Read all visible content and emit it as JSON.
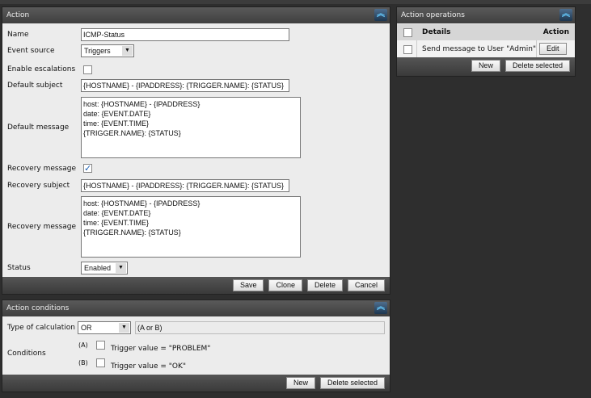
{
  "action": {
    "title": "Action",
    "name_label": "Name",
    "name_value": "ICMP-Status",
    "event_source_label": "Event source",
    "event_source_value": "Triggers",
    "escalations_label": "Enable escalations",
    "default_subject_label": "Default subject",
    "default_subject_value": "{HOSTNAME} - {IPADDRESS}: {TRIGGER.NAME}: {STATUS}",
    "default_message_label": "Default message",
    "default_message_lines": [
      "host: {HOSTNAME} - {IPADDRESS}",
      "date: {EVENT.DATE}",
      "time: {EVENT.TIME}",
      "{TRIGGER.NAME}: {STATUS}"
    ],
    "recovery_checkbox_label": "Recovery message",
    "recovery_subject_label": "Recovery subject",
    "recovery_subject_value": "{HOSTNAME} - {IPADDRESS}: {TRIGGER.NAME}: {STATUS}",
    "recovery_message_label": "Recovery message",
    "recovery_message_lines": [
      "host: {HOSTNAME} - {IPADDRESS}",
      "date: {EVENT.DATE}",
      "time: {EVENT.TIME}",
      "{TRIGGER.NAME}: {STATUS}"
    ],
    "status_label": "Status",
    "status_value": "Enabled",
    "buttons": {
      "save": "Save",
      "clone": "Clone",
      "delete": "Delete",
      "cancel": "Cancel"
    }
  },
  "conditions": {
    "title": "Action conditions",
    "calc_label": "Type of calculation",
    "calc_value": "OR",
    "calc_expr": "(A or B)",
    "conditions_label": "Conditions",
    "items": [
      {
        "tag": "(A)",
        "text": "Trigger value = \"PROBLEM\""
      },
      {
        "tag": "(B)",
        "text": "Trigger value = \"OK\""
      }
    ],
    "buttons": {
      "new": "New",
      "delete_selected": "Delete selected"
    }
  },
  "operations": {
    "title": "Action operations",
    "col_details": "Details",
    "col_action": "Action",
    "rows": [
      {
        "details": "Send message to User \"Admin\"",
        "action": "Edit"
      }
    ],
    "buttons": {
      "new": "New",
      "delete_selected": "Delete selected"
    }
  }
}
